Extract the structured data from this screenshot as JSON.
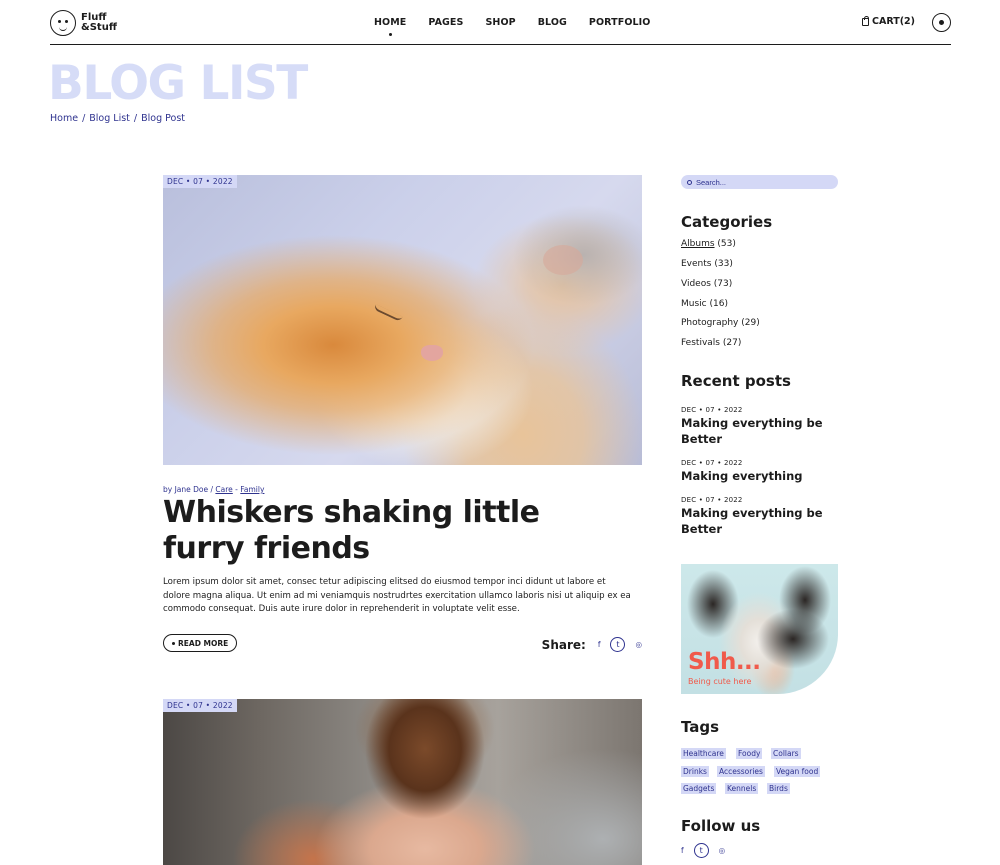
{
  "header": {
    "logo_text": "Fluff &Stuff",
    "nav": [
      "HOME",
      "PAGES",
      "SHOP",
      "BLOG",
      "PORTFOLIO"
    ],
    "cart_label": "CART(2)"
  },
  "page": {
    "title": "BLOG LIST",
    "breadcrumb": [
      "Home",
      "Blog List",
      "Blog Post"
    ]
  },
  "posts": [
    {
      "date": "DEC • 07 • 2022",
      "byline_prefix": "by Jane Doe / ",
      "cat1": "Care",
      "cat_sep": " - ",
      "cat2": "Family",
      "title": "Whiskers shaking little furry friends",
      "excerpt": "Lorem ipsum dolor sit amet, consec tetur adipiscing elitsed do eiusmod tempor inci didunt ut labore et dolore magna aliqua. Ut enim ad mi veniamquis nostrudrtes exercitation ullamco laboris nisi ut aliquip ex ea commodo consequat. Duis aute irure dolor in reprehenderit in voluptate velit esse.",
      "read_more": "READ MORE",
      "share_label": "Share:",
      "image_icon": "sleeping-cat-photo"
    },
    {
      "date": "DEC • 07 • 2022",
      "image_icon": "woman-with-dog-photo"
    }
  ],
  "sidebar": {
    "search_placeholder": "Search...",
    "categories_title": "Categories",
    "categories": [
      {
        "name": "Albums",
        "count": "(53)"
      },
      {
        "name": "Events",
        "count": " (33)"
      },
      {
        "name": "Videos",
        "count": "(73)"
      },
      {
        "name": "Music",
        "count": "(16)"
      },
      {
        "name": "Photography",
        "count": "(29)"
      },
      {
        "name": "Festivals",
        "count": "(27)"
      }
    ],
    "recent_title": "Recent posts",
    "recent": [
      {
        "date": "DEC • 07 • 2022",
        "title": "Making everything be Better"
      },
      {
        "date": "DEC • 07 • 2022",
        "title": "Making everything"
      },
      {
        "date": "DEC • 07 • 2022",
        "title": "Making everything be Better"
      }
    ],
    "ad": {
      "title": "Shh...",
      "subtitle": "Being cute here"
    },
    "tags_title": "Tags",
    "tags": [
      "Healthcare",
      "Foody",
      "Collars",
      "Drinks",
      "Accessories",
      "Vegan food",
      "Gadgets",
      "Kennels",
      "Birds"
    ],
    "follow_title": "Follow us"
  },
  "social": {
    "facebook": "f",
    "twitter": "t",
    "dribbble": "◎"
  },
  "colors": {
    "accent": "#2f338f",
    "accent_light": "#d4d8f6",
    "title_light": "#d6dcf7",
    "ad_red": "#f05a4b"
  }
}
